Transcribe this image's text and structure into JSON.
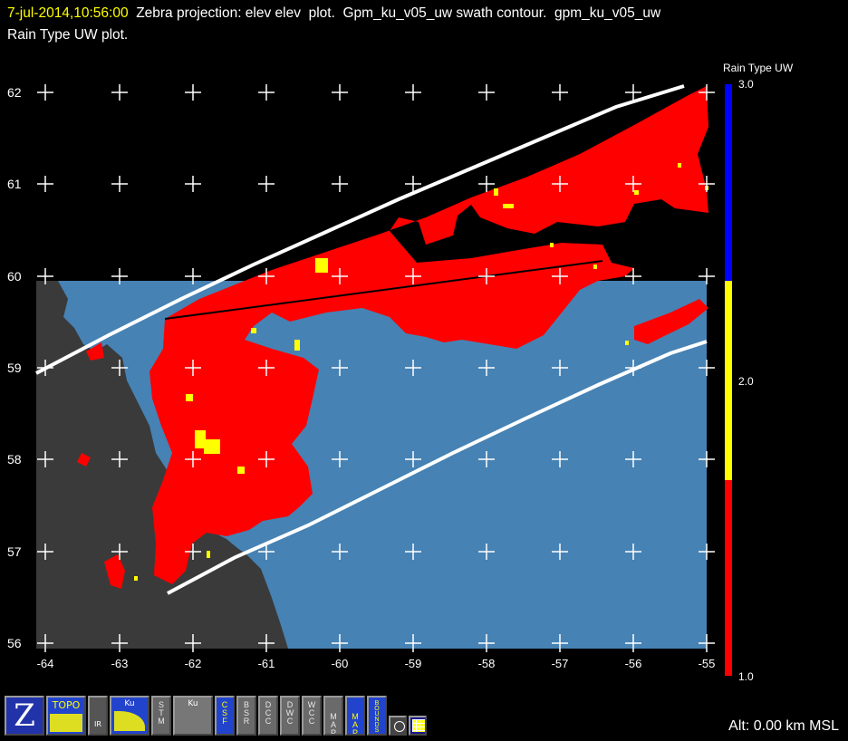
{
  "header": {
    "timestamp": "7-jul-2014,10:56:00",
    "line1_rest": "  Zebra projection: elev elev  plot.  Gpm_ku_v05_uw swath contour.  gpm_ku_v05_uw",
    "line2": "Rain Type UW  plot."
  },
  "legend": {
    "title": "Rain Type UW",
    "labels": [
      "3.0",
      "2.0",
      "1.0"
    ],
    "colors": {
      "stratiform": "#ff0000",
      "convective": "#ffff00",
      "other": "#0000ff"
    }
  },
  "axes": {
    "lat_labels": [
      "62",
      "61",
      "60",
      "59",
      "58",
      "57",
      "56"
    ],
    "lon_labels": [
      "-64",
      "-63",
      "-62",
      "-61",
      "-60",
      "-59",
      "-58",
      "-57",
      "-56",
      "-55"
    ]
  },
  "colors": {
    "ocean": "#4682b4",
    "land": "#3a3a3a",
    "swath_edge": "#ffffff",
    "track": "#000000"
  },
  "toolbar": {
    "buttons": [
      {
        "id": "zebra-logo-button",
        "label": "Z"
      },
      {
        "id": "topo-button",
        "label": "TOPO"
      },
      {
        "id": "ir-button",
        "label": "IR"
      },
      {
        "id": "ku-button",
        "label": "Ku"
      },
      {
        "id": "stm-button",
        "label": "STM"
      },
      {
        "id": "ku-v5-button",
        "label": "Ku"
      },
      {
        "id": "csf-gpm-button",
        "label": "CSF"
      },
      {
        "id": "bsr-button",
        "label": "BSR"
      },
      {
        "id": "dcc-button",
        "label": "DCC"
      },
      {
        "id": "dwc-button",
        "label": "DWC"
      },
      {
        "id": "wcc-button",
        "label": "WCC"
      },
      {
        "id": "map-button",
        "label": "MAP"
      },
      {
        "id": "map2-button",
        "label": "MAP"
      },
      {
        "id": "bounds-button",
        "label": "BOUNDS"
      }
    ]
  },
  "altitude": "Alt: 0.00 km MSL"
}
